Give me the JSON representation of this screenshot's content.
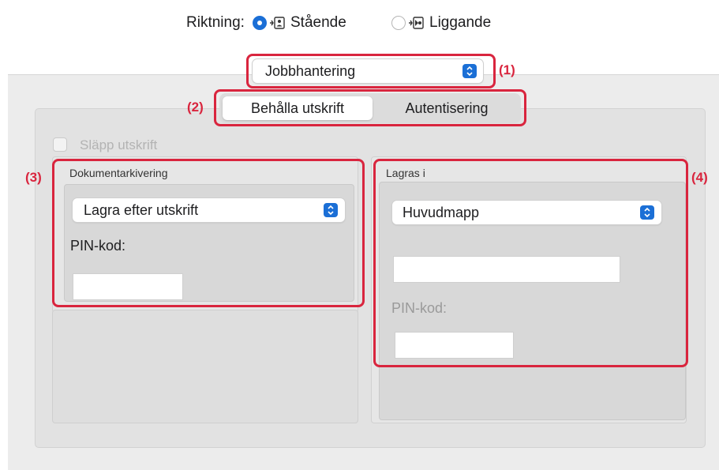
{
  "orientation": {
    "label": "Riktning:",
    "portrait_label": "Stående",
    "landscape_label": "Liggande",
    "selected": "Stående"
  },
  "job_popup": {
    "value": "Jobbhantering"
  },
  "tabs": [
    {
      "label": "Behålla utskrift",
      "selected": true
    },
    {
      "label": "Autentisering",
      "selected": false
    }
  ],
  "release_checkbox": {
    "label": "Släpp utskrift",
    "checked": false,
    "enabled": false
  },
  "document_filing": {
    "title": "Dokumentarkivering",
    "mode_value": "Lagra efter utskrift",
    "pin_label": "PIN-kod:",
    "pin_value": ""
  },
  "store_in": {
    "title": "Lagras i",
    "folder_value": "Huvudmapp",
    "folder_name_value": "",
    "pin_label": "PIN-kod:",
    "pin_value": ""
  },
  "callouts": [
    "(1)",
    "(2)",
    "(3)",
    "(4)"
  ],
  "colors": {
    "accent": "#1b6fd6",
    "callout": "#d9253e"
  }
}
